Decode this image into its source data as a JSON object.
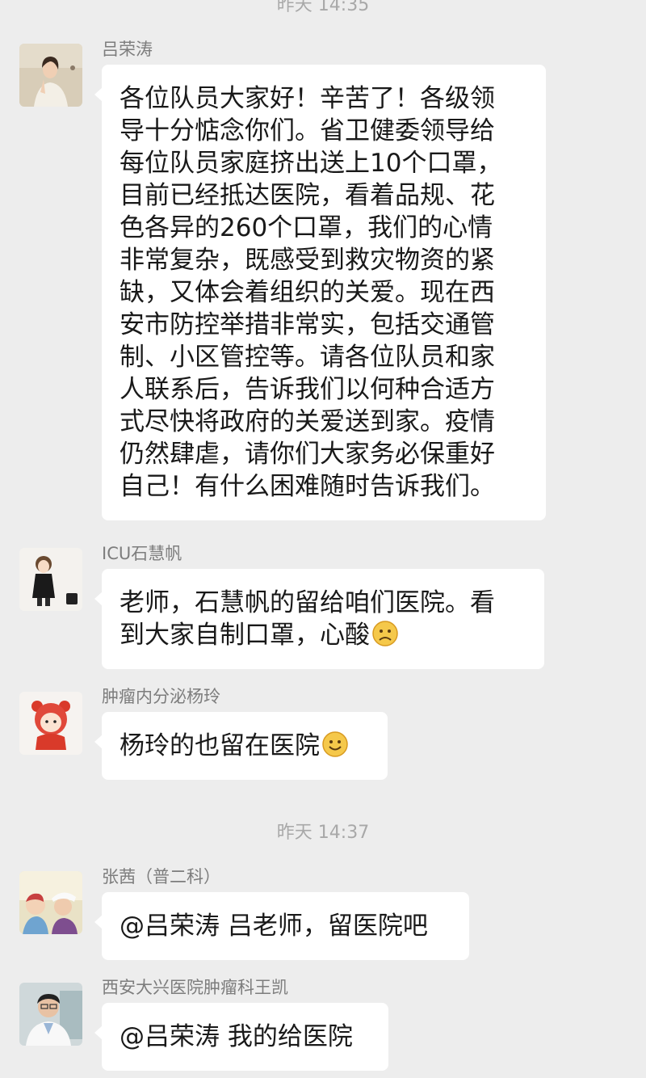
{
  "timestamps": [
    "昨天 14:35",
    "昨天 14:37"
  ],
  "messages": [
    {
      "sender": "吕荣涛",
      "avatar": "portrait-woman-avatar",
      "lines": [
        "各位队员大家好！辛苦了！各级领",
        "导十分惦念你们。省卫健委领导给",
        "每位队员家庭挤出送上10个口罩，",
        "目前已经抵达医院，看着品规、花",
        "色各异的260个口罩，我们的心情",
        "非常复杂，既感受到救灾物资的紧",
        "缺，又体会着组织的关爱。现在西",
        "安市防控举措非常实，包括交通管",
        "制、小区管控等。请各位队员和家",
        "人联系后，告诉我们以何种合适方",
        "式尽快将政府的关爱送到家。疫情",
        "仍然肆虐，请你们大家务必保重好",
        "自己！有什么困难随时告诉我们。"
      ]
    },
    {
      "sender": "ICU石慧帆",
      "avatar": "cartoon-girl-avatar",
      "lines": [
        "老师，石慧帆的留给咱们医院。看",
        "到大家自制口罩，心酸"
      ],
      "emoji": "sad-face-emoji"
    },
    {
      "sender": "肿瘤内分泌杨玲",
      "avatar": "cartoon-tiger-avatar",
      "lines": [
        "杨玲的也留在医院"
      ],
      "emoji": "smile-face-emoji"
    },
    {
      "sender": "张茜（普二科）",
      "avatar": "family-photo-avatar",
      "lines": [
        "@吕荣涛 吕老师，留医院吧"
      ]
    },
    {
      "sender": "西安大兴医院肿瘤科王凯",
      "avatar": "doctor-photo-avatar",
      "lines": [
        "@吕荣涛 我的给医院"
      ]
    }
  ],
  "colors": {
    "background": "#ededed",
    "bubble": "#ffffff",
    "text": "#191919",
    "sender": "#7d7d7d",
    "timestamp": "#a8a8a8",
    "emoji": "#f5c84a"
  }
}
